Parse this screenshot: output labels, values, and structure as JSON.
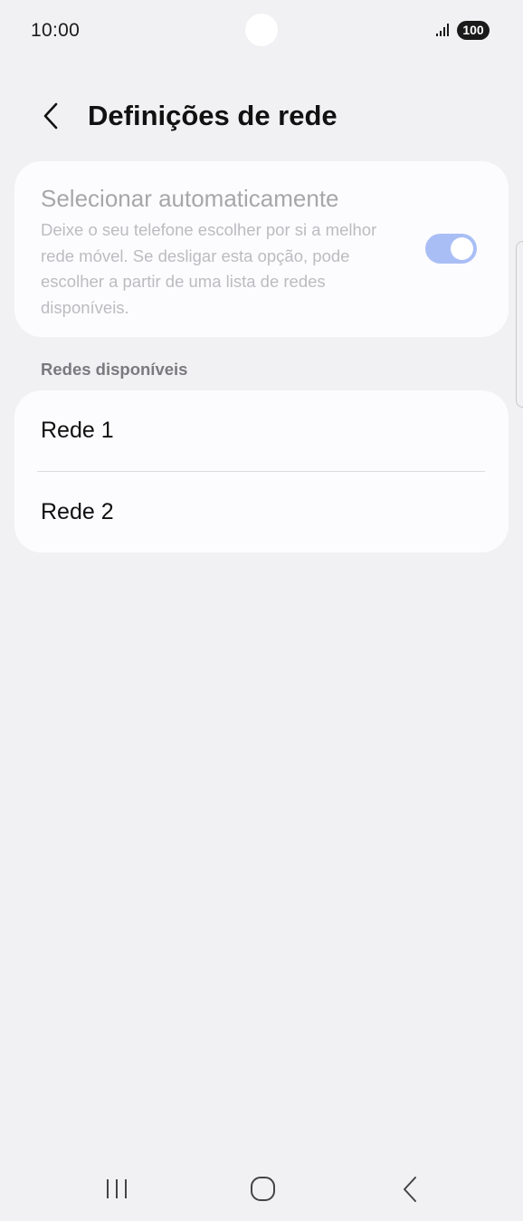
{
  "status_bar": {
    "time": "10:00",
    "battery": "100"
  },
  "header": {
    "title": "Definições de rede"
  },
  "auto_select": {
    "title": "Selecionar automaticamente",
    "description": "Deixe o seu telefone escolher por si a melhor rede móvel. Se desligar esta opção, pode escolher a partir de uma lista de redes disponíveis.",
    "enabled": true,
    "toggle_color": "#a9bef5"
  },
  "networks": {
    "section_label": "Redes disponíveis",
    "items": [
      {
        "label": "Rede 1"
      },
      {
        "label": "Rede 2"
      }
    ]
  },
  "icons": {
    "back": "chevron-left-icon",
    "signal": "signal-icon",
    "recent": "recent-apps-icon",
    "home": "home-icon",
    "nav_back": "back-icon"
  }
}
